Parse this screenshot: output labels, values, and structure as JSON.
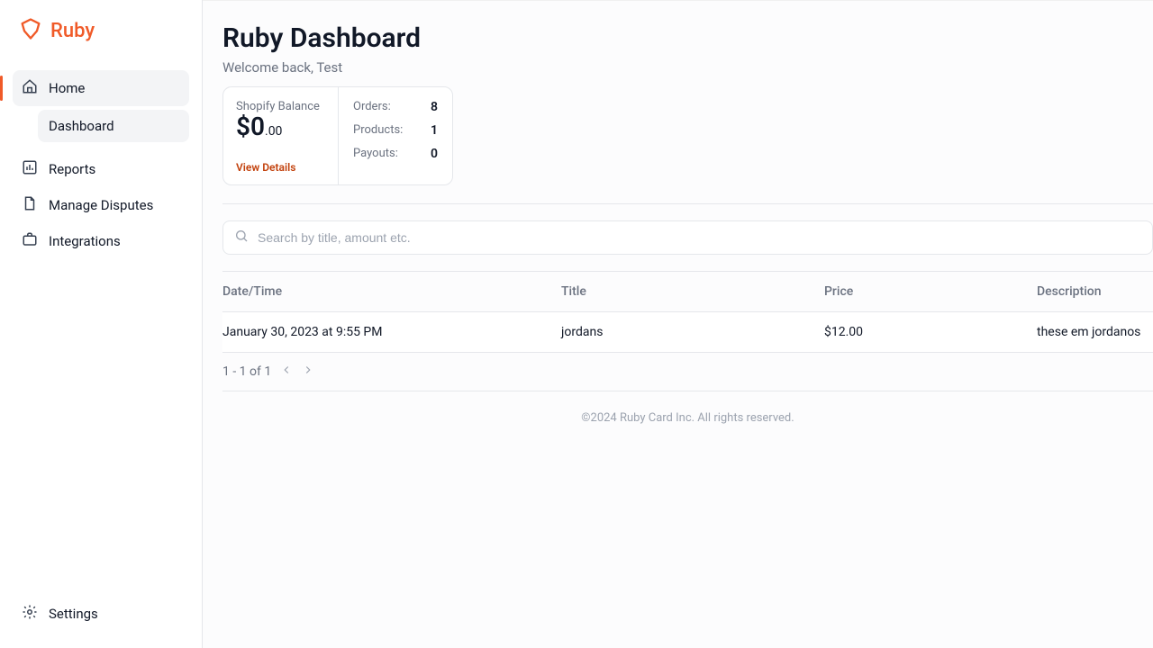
{
  "brand": "Ruby",
  "sidebar": {
    "items": [
      {
        "label": "Home"
      },
      {
        "label": "Reports"
      },
      {
        "label": "Manage Disputes"
      },
      {
        "label": "Integrations"
      }
    ],
    "sub": {
      "label": "Dashboard"
    },
    "settings": "Settings"
  },
  "header": {
    "title": "Ruby Dashboard",
    "welcome": "Welcome back, Test"
  },
  "stats": {
    "balance_label": "Shopify Balance",
    "balance_main": "$0",
    "balance_cents": ".00",
    "view_details": "View Details",
    "rows": [
      {
        "label": "Orders:",
        "value": "8"
      },
      {
        "label": "Products:",
        "value": "1"
      },
      {
        "label": "Payouts:",
        "value": "0"
      }
    ]
  },
  "search": {
    "placeholder": "Search by title, amount etc."
  },
  "table": {
    "headers": [
      "Date/Time",
      "Title",
      "Price",
      "Description"
    ],
    "rows": [
      {
        "date": "January 30, 2023 at 9:55 PM",
        "title": "jordans",
        "price": "$12.00",
        "desc": "these em jordanos"
      }
    ]
  },
  "pagination": {
    "text": "1 - 1 of 1"
  },
  "footer": "©2024 Ruby Card Inc. All rights reserved."
}
